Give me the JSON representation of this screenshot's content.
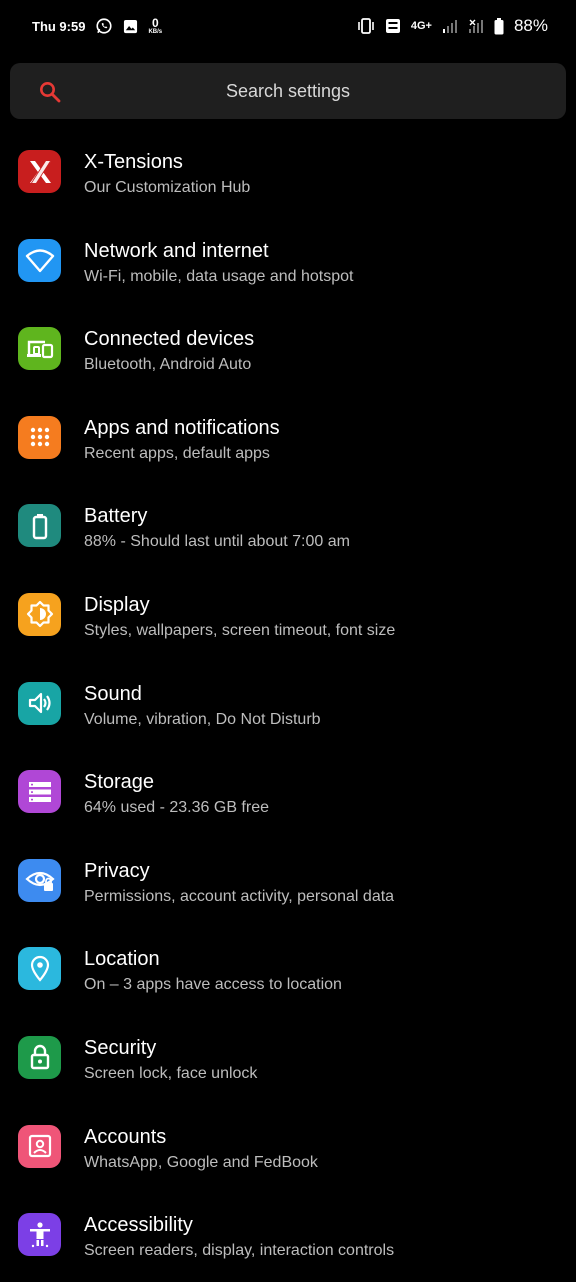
{
  "status_bar": {
    "time": "Thu 9:59",
    "net_speed_value": "0",
    "net_speed_unit": "KB/s",
    "network_type": "4G+",
    "battery_percent": "88%"
  },
  "search": {
    "placeholder": "Search settings",
    "accent_color": "#e53935"
  },
  "items": [
    {
      "title": "X-Tensions",
      "subtitle": "Our Customization Hub",
      "icon": "x-tensions-icon",
      "color": "#c81e1e"
    },
    {
      "title": "Network and internet",
      "subtitle": "Wi-Fi, mobile, data usage and hotspot",
      "icon": "wifi-icon",
      "color": "#2196f3"
    },
    {
      "title": "Connected devices",
      "subtitle": "Bluetooth, Android Auto",
      "icon": "devices-icon",
      "color": "#5fb51e"
    },
    {
      "title": "Apps and notifications",
      "subtitle": "Recent apps, default apps",
      "icon": "apps-grid-icon",
      "color": "#f57c1f"
    },
    {
      "title": "Battery",
      "subtitle": "88% - Should last until about 7:00 am",
      "icon": "battery-icon",
      "color": "#1f8a7e"
    },
    {
      "title": "Display",
      "subtitle": "Styles, wallpapers, screen timeout, font size",
      "icon": "brightness-icon",
      "color": "#f6a21e"
    },
    {
      "title": "Sound",
      "subtitle": "Volume, vibration, Do Not Disturb",
      "icon": "volume-icon",
      "color": "#18a5a5"
    },
    {
      "title": "Storage",
      "subtitle": "64% used - 23.36 GB free",
      "icon": "storage-icon",
      "color": "#b047d6"
    },
    {
      "title": "Privacy",
      "subtitle": "Permissions, account activity, personal data",
      "icon": "privacy-eye-icon",
      "color": "#3d8bf0"
    },
    {
      "title": "Location",
      "subtitle": "On – 3 apps have access to location",
      "icon": "location-pin-icon",
      "color": "#2bb8de"
    },
    {
      "title": "Security",
      "subtitle": "Screen lock, face unlock",
      "icon": "lock-icon",
      "color": "#1e9a4a"
    },
    {
      "title": "Accounts",
      "subtitle": "WhatsApp, Google and FedBook",
      "icon": "account-icon",
      "color": "#ef5578"
    },
    {
      "title": "Accessibility",
      "subtitle": "Screen readers, display, interaction controls",
      "icon": "accessibility-icon",
      "color": "#7c3fe6"
    }
  ]
}
